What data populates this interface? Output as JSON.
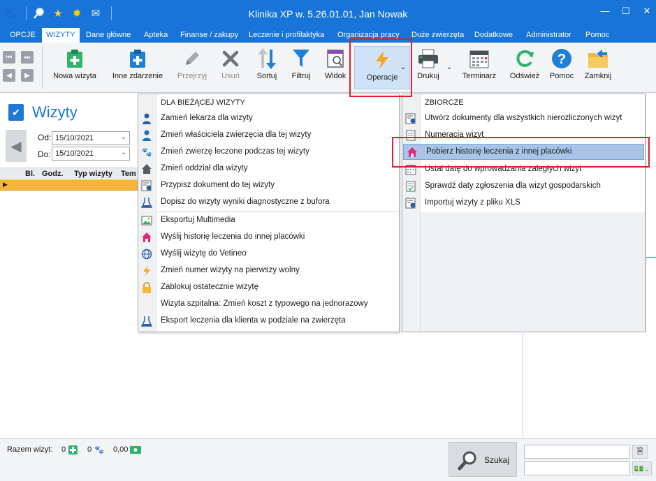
{
  "window": {
    "title": "Klinika XP w. 5.26.01.01, Jan Nowak",
    "controls": [
      "minimize",
      "maximize",
      "close"
    ]
  },
  "quick_icons": [
    "app-logo-icon",
    "search-icon",
    "star-icon",
    "sun-icon",
    "mail-icon"
  ],
  "menubar": {
    "items": [
      "OPCJE",
      "WIZYTY",
      "Dane główne",
      "Apteka",
      "Finanse / zakupy",
      "Leczenie i profilaktyka",
      "Organizacja pracy",
      "Duże zwierzęta",
      "Dodatkowe",
      "Administrator",
      "Pomoc"
    ],
    "active": "WIZYTY"
  },
  "ribbon": {
    "buttons": [
      {
        "label": "Nowa wizyta",
        "icon": "new-visit-icon",
        "enabled": true
      },
      {
        "label": "Inne zdarzenie",
        "icon": "other-event-icon",
        "enabled": true
      },
      {
        "label": "Przejrzyj",
        "icon": "pencil-icon",
        "enabled": false
      },
      {
        "label": "Usuń",
        "icon": "delete-x-icon",
        "enabled": false
      },
      {
        "label": "Sortuj",
        "icon": "sort-icon",
        "enabled": true
      },
      {
        "label": "Filtruj",
        "icon": "filter-icon",
        "enabled": true
      },
      {
        "label": "Widok",
        "icon": "view-icon",
        "enabled": true
      },
      {
        "label": "Operacje",
        "icon": "lightning-icon",
        "enabled": true
      },
      {
        "label": "Drukuj",
        "icon": "printer-icon",
        "enabled": true
      },
      {
        "label": "Terminarz",
        "icon": "calendar-icon",
        "enabled": true
      },
      {
        "label": "Odśwież",
        "icon": "refresh-icon",
        "enabled": true
      },
      {
        "label": "Pomoc",
        "icon": "help-icon",
        "enabled": true
      },
      {
        "label": "Zamknij",
        "icon": "close-folder-icon",
        "enabled": true
      }
    ]
  },
  "left_panel": {
    "title": "Wizyty",
    "date_from_label": "Od:",
    "date_from": "15/10/2021",
    "date_to_label": "Do:",
    "date_to": "15/10/2021",
    "columns": [
      "Bl.",
      "Godz.",
      "Typ wizyty",
      "Tem"
    ]
  },
  "menu_current": {
    "header": "DLA BIEŻĄCEJ WIZYTY",
    "items": [
      {
        "label": "Zamień lekarza dla wizyty",
        "icon": "doctor-icon"
      },
      {
        "label": "Zmień właściciela zwierzęcia dla tej wizyty",
        "icon": "owner-icon"
      },
      {
        "label": "Zmień zwierzę leczone podczas tej wizyty",
        "icon": "paw-icon"
      },
      {
        "label": "Zmień oddział dla wizyty",
        "icon": "house-icon"
      },
      {
        "label": "Przypisz dokument do tej wizyty",
        "icon": "document-gear-icon"
      },
      {
        "label": "Dopisz do wizyty wyniki diagnostyczne z bufora",
        "icon": "flask-icon"
      },
      {
        "label": "Eksportuj Multimedia",
        "icon": "media-icon"
      },
      {
        "label": "Wyślij historię leczenia do innej placówki",
        "icon": "send-house-icon"
      },
      {
        "label": "Wyślij wizytę do Vetineo",
        "icon": "globe-icon"
      },
      {
        "label": "Zmień numer wizyty na pierwszy wolny",
        "icon": "lightning-icon"
      },
      {
        "label": "Zablokuj ostatecznie wizytę",
        "icon": "lock-icon"
      },
      {
        "label": "Wizyta szpitalna: Zmień koszt z typowego na jednorazowy",
        "icon": ""
      },
      {
        "label": "Eksport leczenia dla klienta w podziale na zwierzęta",
        "icon": "flask-icon"
      }
    ]
  },
  "menu_collective": {
    "header": "ZBIORCZE",
    "items": [
      {
        "label": "Utwórz dokumenty dla wszystkich nierozliczonych wizyt",
        "icon": "document-gear-icon"
      },
      {
        "label": "Numeracja wizyt",
        "icon": "numbering-icon"
      },
      {
        "label": "Pobierz historię leczenia z innej placówki",
        "icon": "receive-house-icon",
        "highlighted": true
      },
      {
        "label": "Ustal datę do wprowadzania zaległych wizyt",
        "icon": "calendar-icon"
      },
      {
        "label": "Sprawdź daty zgłoszenia dla wizyt gospodarskich",
        "icon": "check-doc-icon"
      },
      {
        "label": "Importuj wizyty z pliku XLS",
        "icon": "document-gear-icon"
      }
    ]
  },
  "status": {
    "total_label": "Razem wizyt:",
    "visits_count": "0",
    "animals_count": "0",
    "amount": "0,00",
    "search_label": "Szukaj"
  },
  "colors": {
    "accent": "#1874d8",
    "highlight": "#a8c4e6",
    "selected_row": "#f6b43c",
    "annotation_red": "#e0202a"
  }
}
